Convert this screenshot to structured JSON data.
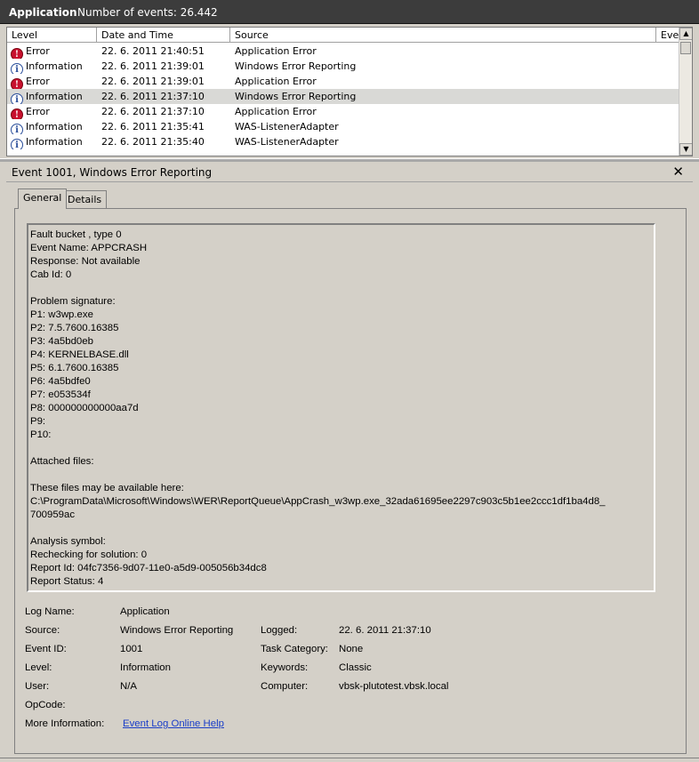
{
  "titlebar": {
    "app": "Application",
    "count": "Number of events: 26.442"
  },
  "columns": [
    "Level",
    "Date and Time",
    "Source",
    "Eve"
  ],
  "rows": [
    {
      "level": "Error",
      "icon": "error-icon",
      "date": "22. 6. 2011 21:40:51",
      "source": "Application Error"
    },
    {
      "level": "Information",
      "icon": "info-icon",
      "date": "22. 6. 2011 21:39:01",
      "source": "Windows Error Reporting"
    },
    {
      "level": "Error",
      "icon": "error-icon",
      "date": "22. 6. 2011 21:39:01",
      "source": "Application Error"
    },
    {
      "level": "Information",
      "icon": "info-icon",
      "date": "22. 6. 2011 21:37:10",
      "source": "Windows Error Reporting",
      "selected": true
    },
    {
      "level": "Error",
      "icon": "error-icon",
      "date": "22. 6. 2011 21:37:10",
      "source": "Application Error"
    },
    {
      "level": "Information",
      "icon": "info-icon",
      "date": "22. 6. 2011 21:35:41",
      "source": "WAS-ListenerAdapter"
    },
    {
      "level": "Information",
      "icon": "info-icon",
      "date": "22. 6. 2011 21:35:40",
      "source": "WAS-ListenerAdapter"
    }
  ],
  "detail": {
    "title": "Event 1001, Windows Error Reporting",
    "close": "✕",
    "tabs": [
      "General",
      "Details"
    ],
    "description": "Fault bucket , type 0\nEvent Name: APPCRASH\nResponse: Not available\nCab Id: 0\n\nProblem signature:\nP1: w3wp.exe\nP2: 7.5.7600.16385\nP3: 4a5bd0eb\nP4: KERNELBASE.dll\nP5: 6.1.7600.16385\nP6: 4a5bdfe0\nP7: e053534f\nP8: 000000000000aa7d\nP9:\nP10:\n\nAttached files:\n\nThese files may be available here:\nC:\\ProgramData\\Microsoft\\Windows\\WER\\ReportQueue\\AppCrash_w3wp.exe_32ada61695ee2297c903c5b1ee2ccc1df1ba4d8_\n700959ac\n\nAnalysis symbol:\nRechecking for solution: 0\nReport Id: 04fc7356-9d07-11e0-a5d9-005056b34dc8\nReport Status: 4",
    "fields": {
      "log_name_label": "Log Name:",
      "log_name": "Application",
      "source_label": "Source:",
      "source": "Windows Error Reporting",
      "logged_label": "Logged:",
      "logged": "22. 6. 2011 21:37:10",
      "event_id_label": "Event ID:",
      "event_id": "1001",
      "task_label": "Task Category:",
      "task": "None",
      "level_label": "Level:",
      "level": "Information",
      "keywords_label": "Keywords:",
      "keywords": "Classic",
      "user_label": "User:",
      "user": "N/A",
      "computer_label": "Computer:",
      "computer": "vbsk-plutotest.vbsk.local",
      "opcode_label": "OpCode:",
      "more_info_label": "More Information:",
      "more_info_link": "Event Log Online Help"
    }
  }
}
